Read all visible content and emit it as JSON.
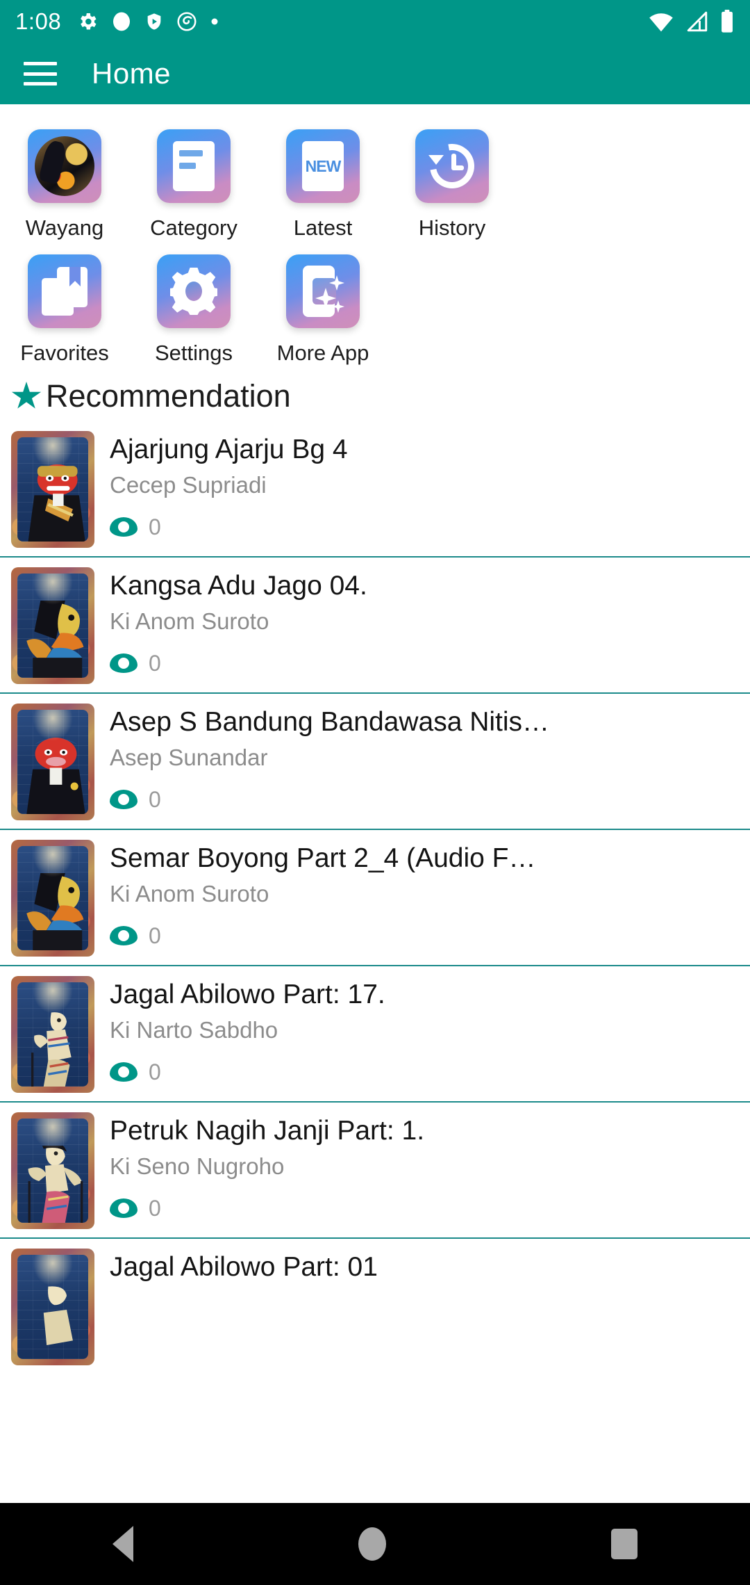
{
  "status_bar": {
    "clock": "1:08",
    "left_icons": [
      "gear-icon",
      "circle-icon",
      "shield-play-icon",
      "spiral-icon",
      "dot-icon"
    ],
    "right_icons": [
      "wifi-icon",
      "cellular-signal-icon",
      "battery-icon"
    ]
  },
  "app_bar": {
    "menu_icon": "hamburger-menu-icon",
    "title": "Home",
    "background_color": "#009688"
  },
  "grid_menu": {
    "items": [
      {
        "label": "Wayang",
        "icon": "wayang-art-icon"
      },
      {
        "label": "Category",
        "icon": "category-card-icon"
      },
      {
        "label": "Latest",
        "icon": "new-badge-icon"
      },
      {
        "label": "History",
        "icon": "history-clock-icon"
      },
      {
        "label": "Favorites",
        "icon": "bookmark-books-icon"
      },
      {
        "label": "Settings",
        "icon": "gear-icon"
      },
      {
        "label": "More App",
        "icon": "more-app-sparkle-icon"
      }
    ]
  },
  "recommendation": {
    "icon": "star-icon",
    "title": "Recommendation",
    "accent_color": "#009688",
    "items": [
      {
        "title": "Ajarjung Ajarju Bg 4",
        "author": "Cecep Supriadi",
        "views": "0"
      },
      {
        "title": "Kangsa Adu Jago   04.",
        "author": "Ki Anom Suroto",
        "views": "0"
      },
      {
        "title": "Asep S   Bandung Bandawasa Nitis…",
        "author": "Asep Sunandar",
        "views": "0"
      },
      {
        "title": "Semar Boyong   Part 2_4 (Audio F…",
        "author": "Ki Anom Suroto",
        "views": "0"
      },
      {
        "title": "Jagal Abilowo Part: 17.",
        "author": "Ki Narto Sabdho",
        "views": "0"
      },
      {
        "title": "Petruk Nagih Janji Part: 1.",
        "author": "Ki Seno Nugroho",
        "views": "0"
      },
      {
        "title": "Jagal Abilowo Part: 01",
        "author": "",
        "views": ""
      }
    ],
    "views_icon": "eye-icon"
  },
  "nav_bar": {
    "back": "back-triangle-icon",
    "home": "home-circle-icon",
    "recents": "recents-square-icon"
  }
}
